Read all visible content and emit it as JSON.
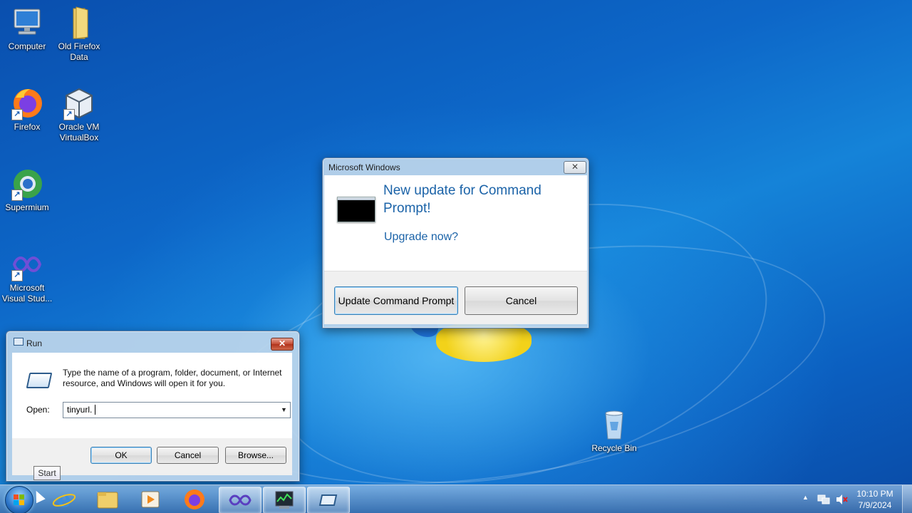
{
  "desktop": {
    "icons": [
      {
        "label": "Computer",
        "icon": "computer-icon"
      },
      {
        "label": "Old Firefox Data",
        "icon": "folder-icon"
      },
      {
        "label": "Firefox",
        "icon": "firefox-icon"
      },
      {
        "label": "Oracle VM VirtualBox",
        "icon": "virtualbox-icon"
      },
      {
        "label": "Supermium",
        "icon": "supermium-icon"
      },
      {
        "label": "Microsoft Visual Stud...",
        "icon": "visual-studio-icon"
      },
      {
        "label": "Recycle Bin",
        "icon": "recycle-bin-icon"
      }
    ]
  },
  "ms_dialog": {
    "title": "Microsoft Windows",
    "close_label": "✕",
    "heading": "New update for Command Prompt!",
    "link": "Upgrade now?",
    "primary_button": "Update Command Prompt",
    "cancel_button": "Cancel"
  },
  "run_dialog": {
    "title": "Run",
    "close_label": "✕",
    "description": "Type the name of a program, folder, document, or Internet resource, and Windows will open it for you.",
    "open_label": "Open:",
    "open_value": "tinyurl.",
    "dropdown_arrow": "▼",
    "ok_button": "OK",
    "cancel_button": "Cancel",
    "browse_button": "Browse..."
  },
  "tooltip": {
    "text": "Start"
  },
  "taskbar": {
    "pinned": [
      {
        "icon": "internet-explorer-icon",
        "active": false
      },
      {
        "icon": "file-explorer-icon",
        "active": false
      },
      {
        "icon": "media-player-icon",
        "active": false
      },
      {
        "icon": "firefox-icon",
        "active": false
      },
      {
        "icon": "visual-studio-icon",
        "active": true
      },
      {
        "icon": "task-manager-icon",
        "active": true
      },
      {
        "icon": "run-icon",
        "active": true
      }
    ],
    "tray": {
      "show_hidden": "▲",
      "time": "10:10 PM",
      "date": "7/9/2024"
    }
  },
  "colors": {
    "link_blue": "#1b63a8",
    "desktop_blue": "#0d67c8"
  }
}
